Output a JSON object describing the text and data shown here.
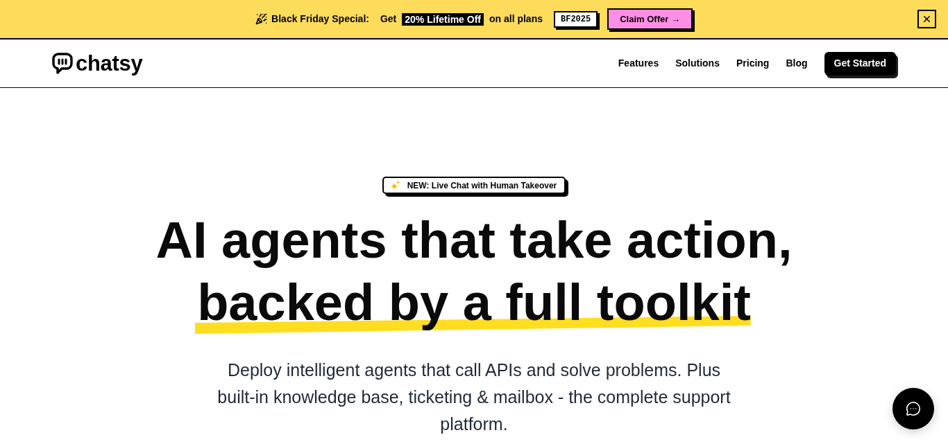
{
  "banner": {
    "title": "Black Friday Special:",
    "lead": "Get",
    "highlight": "20% Lifetime Off",
    "tail": "on all plans",
    "code": "BF2025",
    "button": "Claim Offer →"
  },
  "nav": {
    "logo": "chatsy",
    "links": [
      "Features",
      "Solutions",
      "Pricing",
      "Blog"
    ],
    "cta": "Get Started"
  },
  "hero": {
    "badge": "NEW: Live Chat with Human Takeover",
    "title_lines": [
      {
        "text": "AI agents that take action,",
        "highlighted": false
      },
      {
        "text": "backed by a full toolkit",
        "highlighted": true
      }
    ],
    "subtitle": "Deploy intelligent agents that call APIs and solve problems. Plus built-in knowledge base, ticketing & mailbox - the complete support platform."
  }
}
